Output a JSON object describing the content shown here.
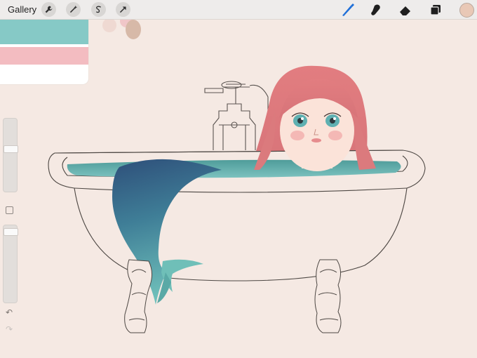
{
  "topbar": {
    "gallery_label": "Gallery",
    "left_tools": [
      {
        "name": "wrench-icon"
      },
      {
        "name": "magic-wand-icon"
      },
      {
        "name": "selection-s-icon"
      },
      {
        "name": "transform-arrow-icon"
      }
    ],
    "right_tools": [
      {
        "name": "brush-icon",
        "active": true
      },
      {
        "name": "smudge-icon"
      },
      {
        "name": "eraser-icon"
      },
      {
        "name": "layers-icon"
      }
    ],
    "current_color": "#e9c8b6"
  },
  "palette": {
    "colors": [
      "#86c9c6",
      "#f3bcc1"
    ]
  },
  "sidebar": {
    "brush_size_level": 0.2,
    "opacity_level": 0.05,
    "undo_icon": "undo-arrow-icon",
    "redo_icon": "redo-arrow-icon"
  },
  "colors": {
    "canvas_bg": "#f5e9e3",
    "accent_active": "#1f6fd8",
    "hair": "#e07e80",
    "water": "#5aa9a6",
    "tail_dark": "#2e4f7a",
    "tail_light": "#5fb3b2"
  }
}
